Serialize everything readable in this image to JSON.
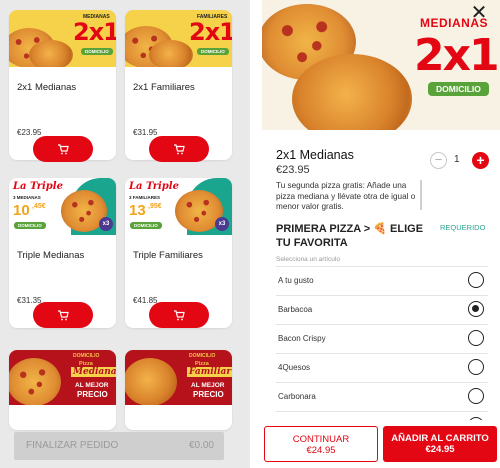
{
  "products": [
    {
      "title": "2x1 Medianas",
      "price": "€23.95",
      "banner": {
        "tag": "MEDIANAS",
        "big": "2x1",
        "badge": "DOMICILIO"
      }
    },
    {
      "title": "2x1 Familiares",
      "price": "€31.95",
      "banner": {
        "tag": "FAMILIARES",
        "big": "2x1",
        "badge": "DOMICILIO"
      }
    },
    {
      "title": "Triple Medianas",
      "price": "€31.35",
      "banner": {
        "logo": "La Triple",
        "tag": "3 MEDIANAS",
        "price_big": "10",
        "price_small": ",45€",
        "badge": "DOMICILIO",
        "x3": "x3"
      }
    },
    {
      "title": "Triple Familiares",
      "price": "€41.85",
      "banner": {
        "logo": "La Triple",
        "tag": "3 FAMILIARES",
        "price_big": "13",
        "price_small": ",95€",
        "badge": "DOMICILIO",
        "x3": "x3"
      }
    },
    {
      "banner": {
        "top": "DOMICILIO",
        "line1": "Pizza",
        "line2": "Mediana",
        "line3": "AL MEJOR",
        "line4": "PRECIO"
      }
    },
    {
      "banner": {
        "top": "DOMICILIO",
        "line1": "Pizza",
        "line2": "Familiar",
        "line3": "AL MEJOR",
        "line4": "PRECIO"
      }
    }
  ],
  "cart_bar": {
    "label": "FINALIZAR PEDIDO",
    "amount": "€0.00"
  },
  "detail": {
    "close_icon": "close-icon",
    "hero": {
      "tag": "MEDIANAS",
      "big": "2x1",
      "badge": "DOMICILIO"
    },
    "title": "2x1 Medianas",
    "price": "€23.95",
    "quantity": "1",
    "description": "Tu segunda pizza gratis: Añade una pizza mediana y llévate otra de igual o menor valor gratis.",
    "section_title": "PRIMERA PIZZA > 🍕 ELIGE TU FAVORITA",
    "required": "REQUERIDO",
    "hint": "Selecciona un artículo",
    "options": [
      {
        "label": "A tu gusto",
        "selected": false
      },
      {
        "label": "Barbacoa",
        "selected": true
      },
      {
        "label": "Bacon Crispy",
        "selected": false
      },
      {
        "label": "4Quesos",
        "selected": false
      },
      {
        "label": "Carbonara",
        "selected": false
      },
      {
        "label": "",
        "selected": false
      }
    ],
    "continue_label": "CONTINUAR",
    "continue_price": "€24.95",
    "add_label": "AÑADIR AL CARRITO",
    "add_price": "€24.95"
  },
  "colors": {
    "brand_red": "#e30613",
    "accent_green": "#5aa33a",
    "required_teal": "#2aa58f"
  }
}
